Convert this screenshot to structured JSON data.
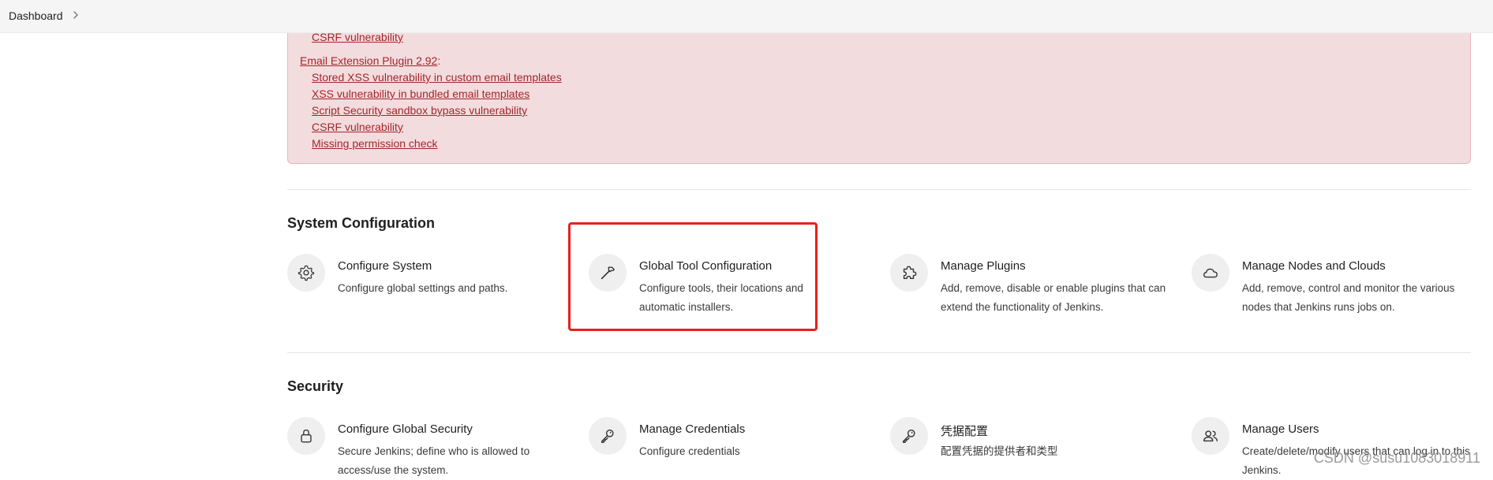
{
  "breadcrumb": {
    "items": [
      "Dashboard"
    ]
  },
  "alert": {
    "lines": [
      {
        "text": "CSRF vulnerability"
      },
      {
        "text": "Email Extension Plugin 2.92",
        "suffix": ":"
      },
      {
        "text": "Stored XSS vulnerability in custom email templates"
      },
      {
        "text": "XSS vulnerability in bundled email templates"
      },
      {
        "text": "Script Security sandbox bypass vulnerability"
      },
      {
        "text": "CSRF vulnerability"
      },
      {
        "text": "Missing permission check"
      }
    ]
  },
  "sections": [
    {
      "title": "System Configuration",
      "items": [
        {
          "title": "Configure System",
          "desc": "Configure global settings and paths.",
          "icon": "gear-icon"
        },
        {
          "title": "Global Tool Configuration",
          "desc": "Configure tools, their locations and automatic installers.",
          "icon": "hammer-icon"
        },
        {
          "title": "Manage Plugins",
          "desc": "Add, remove, disable or enable plugins that can extend the functionality of Jenkins.",
          "icon": "puzzle-icon"
        },
        {
          "title": "Manage Nodes and Clouds",
          "desc": "Add, remove, control and monitor the various nodes that Jenkins runs jobs on.",
          "icon": "cloud-icon"
        }
      ]
    },
    {
      "title": "Security",
      "items": [
        {
          "title": "Configure Global Security",
          "desc": "Secure Jenkins; define who is allowed to access/use the system.",
          "icon": "lock-icon"
        },
        {
          "title": "Manage Credentials",
          "desc": "Configure credentials",
          "icon": "key-icon"
        },
        {
          "title": "凭据配置",
          "desc": "配置凭据的提供者和类型",
          "icon": "key-icon"
        },
        {
          "title": "Manage Users",
          "desc": "Create/delete/modify users that can log in to this Jenkins.",
          "icon": "users-icon"
        }
      ]
    }
  ],
  "watermark": "CSDN @susu1083018911",
  "colors": {
    "alert_bg": "#f3dcde",
    "alert_link": "#a3262b",
    "highlight": "#e8201b",
    "icon_bg": "#efefef"
  }
}
